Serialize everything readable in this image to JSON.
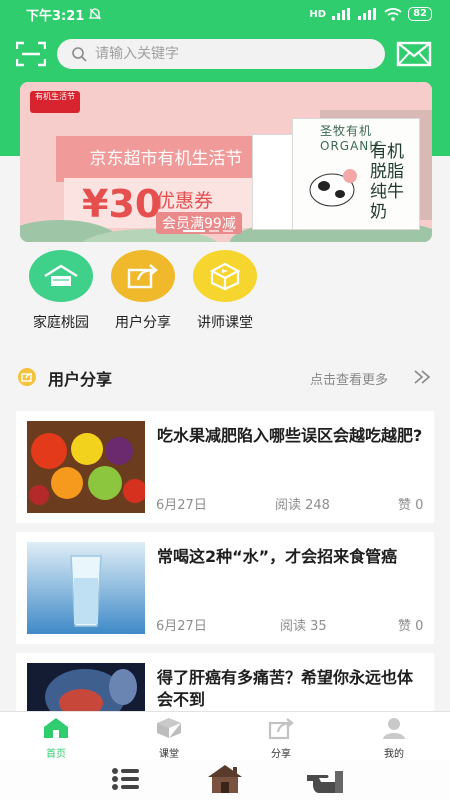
{
  "status_bar": {
    "time": "下午3:21",
    "signal_label": "HD",
    "battery": "82"
  },
  "search": {
    "placeholder": "请输入关键字"
  },
  "banner": {
    "logo_text": "有机生活节",
    "title": "京东超市有机生活节",
    "price": "¥30",
    "coupon_name": "优惠券",
    "coupon_condition": "会员满99减",
    "brand": "圣牧有机 ORGANIC",
    "product": "有机脱脂纯牛奶",
    "slide_count": 3,
    "active_slide": 1
  },
  "quick_actions": [
    {
      "label": "家庭桃园",
      "icon": "house-icon",
      "color": "#3fd08a"
    },
    {
      "label": "用户分享",
      "icon": "share-icon",
      "color": "#f0b92c"
    },
    {
      "label": "讲师课堂",
      "icon": "play-box-icon",
      "color": "#f6d52e"
    }
  ],
  "section": {
    "title": "用户分享",
    "more_label": "点击查看更多"
  },
  "articles": [
    {
      "title": "吃水果减肥陷入哪些误区会越吃越肥?",
      "date": "6月27日",
      "reads": "阅读 248",
      "likes": "赞 0",
      "image": "fruit-image"
    },
    {
      "title": "常喝这2种“水”，才会招来食管癌",
      "date": "6月27日",
      "reads": "阅读 35",
      "likes": "赞 0",
      "image": "water-glass-image"
    },
    {
      "title": "得了肝癌有多痛苦？希望你永远也体会不到",
      "date": "",
      "reads": "",
      "likes": "",
      "image": "xray-image"
    }
  ],
  "tab_bar": [
    {
      "label": "首页",
      "icon": "home-icon",
      "active": true
    },
    {
      "label": "课堂",
      "icon": "classroom-icon",
      "active": false
    },
    {
      "label": "分享",
      "icon": "share-icon",
      "active": false
    },
    {
      "label": "我的",
      "icon": "user-icon",
      "active": false
    }
  ],
  "colors": {
    "primary": "#2fcd6e",
    "accent_pink": "#e5504f"
  }
}
